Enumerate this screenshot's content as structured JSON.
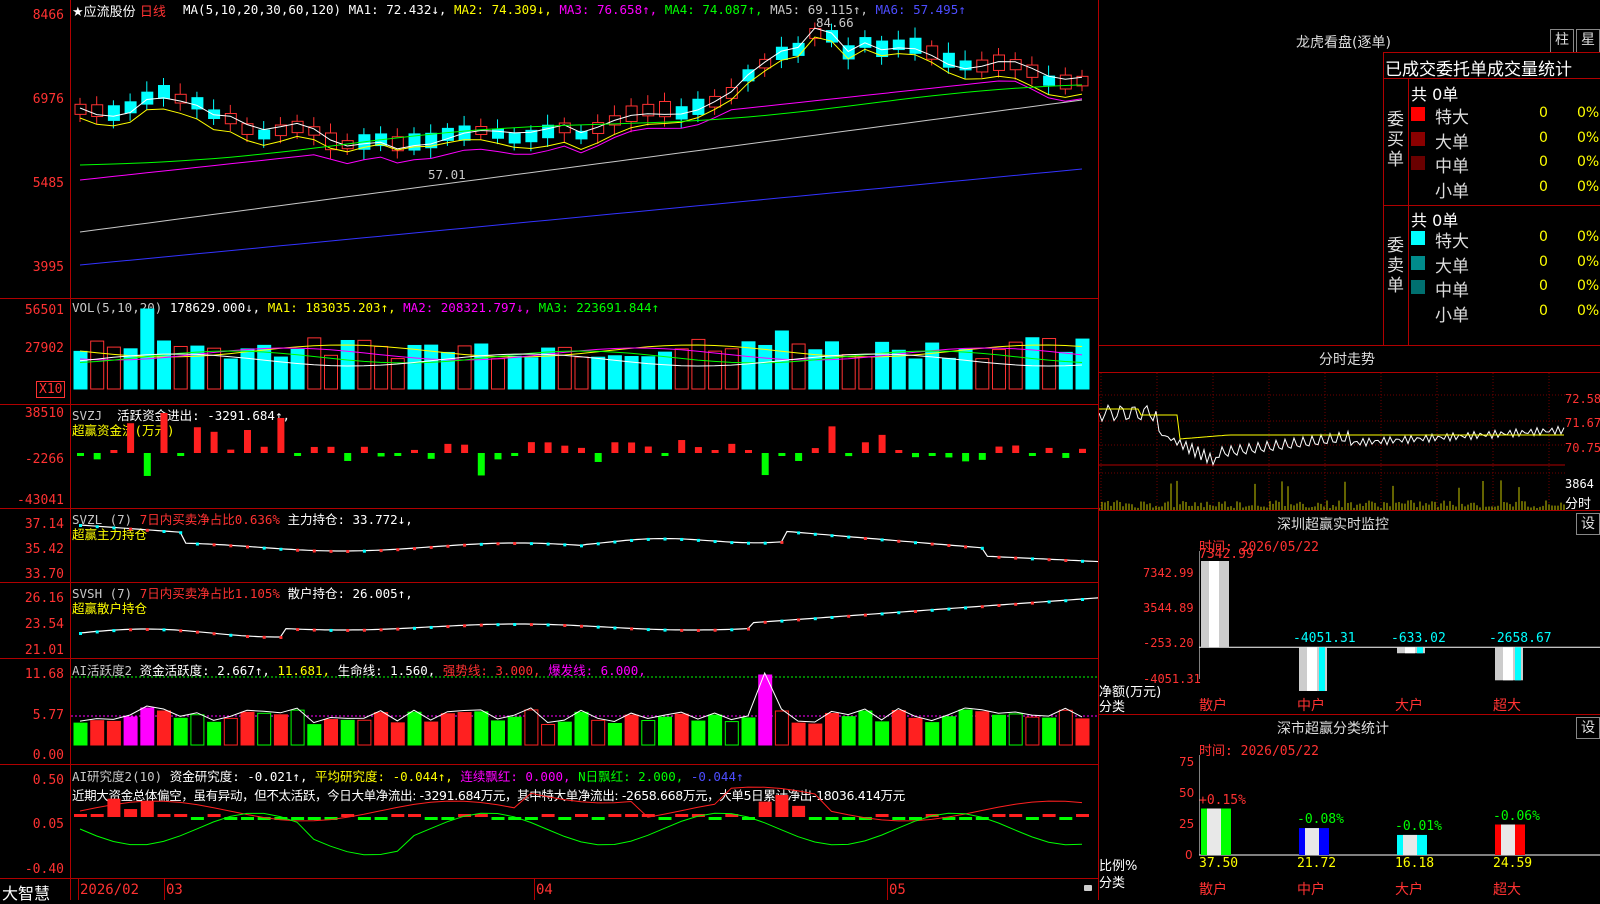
{
  "main": {
    "header": {
      "star": "★",
      "name": "应流股份",
      "period": "日线",
      "ma_params": "MA(5,10,20,30,60,120)",
      "ma1": "MA1: 72.432↓,",
      "ma2": "MA2: 74.309↓,",
      "ma3": "MA3: 76.658↑,",
      "ma4": "MA4: 74.087↑,",
      "ma5": "MA5: 69.115↑,",
      "ma6": "MA6: 57.495↑"
    },
    "yticks": [
      "8466",
      "6976",
      "5485",
      "3995"
    ],
    "high_label": "84.66",
    "low_label": "57.01"
  },
  "vol": {
    "header": "VOL(5,10,20)",
    "value": "178629.000↓,",
    "ma1": "MA1: 183035.203↑,",
    "ma2": "MA2: 208321.797↓,",
    "ma3": "MA3: 223691.844↑",
    "yticks": [
      "56501",
      "27902"
    ],
    "unit": "X10"
  },
  "svzj": {
    "name": "SVZJ",
    "text": "活跃资金进出: -3291.684↑,",
    "sub": "超赢资金流(万元)",
    "yticks": [
      "38510",
      "-2266",
      "-43041"
    ]
  },
  "svzl": {
    "name": "SVZL (7)",
    "text1": "7日内买卖净占比0.636%",
    "text2": "主力持仓: 33.772↓,",
    "sub": "超赢主力持仓",
    "yticks": [
      "37.14",
      "35.42",
      "33.70"
    ]
  },
  "svsh": {
    "name": "SVSH (7)",
    "text1": "7日内买卖净占比1.105%",
    "text2": "散户持仓: 26.005↑,",
    "sub": "超赢散户持仓",
    "yticks": [
      "26.16",
      "23.54",
      "21.01"
    ]
  },
  "ai1": {
    "name": "AI活跃度2",
    "t1": "资金活跃度: 2.667↑,",
    "t2": "11.681,",
    "t3": "生命线: 1.560,",
    "t4": "强势线: 3.000,",
    "t5": "爆发线: 6.000,",
    "yticks": [
      "11.68",
      "5.77",
      "0.00"
    ]
  },
  "ai2": {
    "name": "AI研究度2(10)",
    "t1": "资金研究度: -0.021↑,",
    "t2": "平均研究度: -0.044↑,",
    "t3": "连续飘红: 0.000,",
    "t4": "N日飘红: 2.000,",
    "t5": "-0.044↑",
    "comment": "近期大资金总体偏空，虽有异动，但不太活跃，今日大单净流出: -3291.684万元，其中特大单净流出: -2658.668万元，大单5日累计净出-18036.414万元",
    "yticks": [
      "0.50",
      "0.05",
      "-0.40"
    ]
  },
  "xaxis": {
    "brand": "大智慧",
    "labels": [
      "2026/02",
      "03",
      "04",
      "05"
    ]
  },
  "lhb": {
    "title": "龙虎看盘(逐单)",
    "btn1": "柱",
    "btn2": "星",
    "subtitle": "已成交委托单成交量统计",
    "buy": {
      "side": "委买单",
      "total": "共 0单",
      "rows": [
        {
          "name": "特大",
          "v": "0",
          "p": "0%",
          "color": "#ff0000"
        },
        {
          "name": "大单",
          "v": "0",
          "p": "0%",
          "color": "#8b0000"
        },
        {
          "name": "中单",
          "v": "0",
          "p": "0%",
          "color": "#6a0000"
        },
        {
          "name": "小单",
          "v": "0",
          "p": "0%",
          "color": ""
        }
      ]
    },
    "sell": {
      "side": "委卖单",
      "total": "共 0单",
      "rows": [
        {
          "name": "特大",
          "v": "0",
          "p": "0%",
          "color": "#00ffff"
        },
        {
          "name": "大单",
          "v": "0",
          "p": "0%",
          "color": "#008b8b"
        },
        {
          "name": "中单",
          "v": "0",
          "p": "0%",
          "color": "#007070"
        },
        {
          "name": "小单",
          "v": "0",
          "p": "0%",
          "color": ""
        }
      ]
    }
  },
  "fenshi": {
    "title": "分时走势",
    "r1": "72.58",
    "r2": "71.67",
    "r3": "70.75",
    "r4": "3864",
    "r5": "分时"
  },
  "sz": {
    "title": "深圳超赢实时监控",
    "btn": "设",
    "time": "时间: 2026/05/22",
    "yticks": [
      "7342.99",
      "3544.89",
      "-253.20",
      "-4051.31"
    ],
    "ylab1": "净额(万元)",
    "ylab2": "分类",
    "bars": [
      {
        "cat": "散户",
        "val": "7342.99"
      },
      {
        "cat": "中户",
        "val": "-4051.31"
      },
      {
        "cat": "大户",
        "val": "-633.02"
      },
      {
        "cat": "超大",
        "val": "-2658.67"
      }
    ]
  },
  "ss": {
    "title": "深市超赢分类统计",
    "btn": "设",
    "time": "时间: 2026/05/22",
    "yticks": [
      "75",
      "50",
      "25",
      "0"
    ],
    "ylab1": "比例%",
    "ylab2": "分类",
    "bars": [
      {
        "cat": "散户",
        "pct": "+0.15%",
        "val": "37.50",
        "color": "#00ff00"
      },
      {
        "cat": "中户",
        "pct": "-0.08%",
        "val": "21.72",
        "color": "#0000ff"
      },
      {
        "cat": "大户",
        "pct": "-0.01%",
        "val": "16.18",
        "color": "#00ffff"
      },
      {
        "cat": "超大",
        "pct": "-0.06%",
        "val": "24.59",
        "color": "#ff0000"
      }
    ]
  }
}
